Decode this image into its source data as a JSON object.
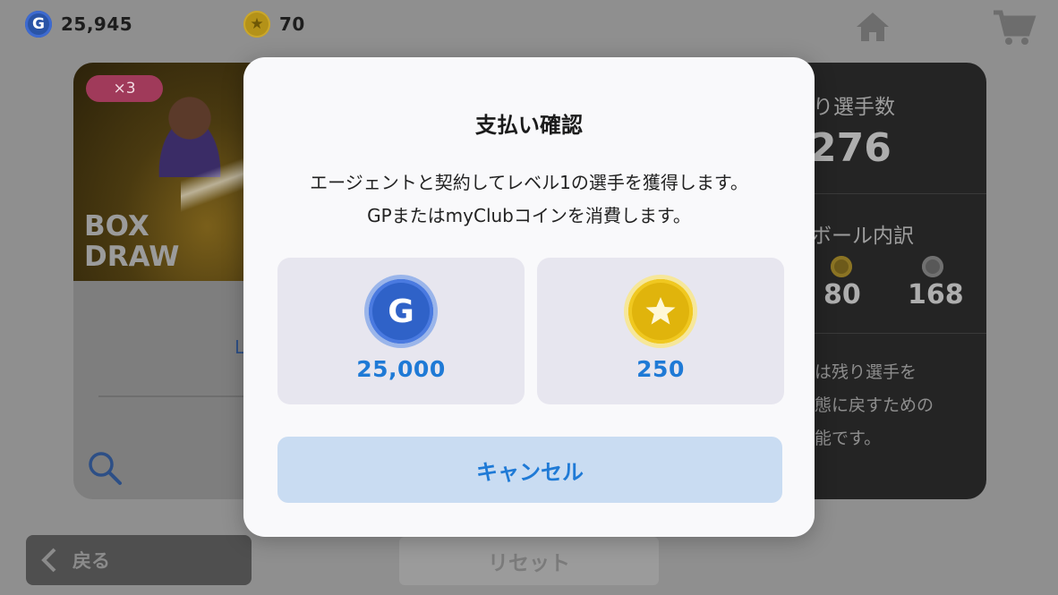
{
  "topbar": {
    "gp": {
      "icon": "gp-coin-icon",
      "letter": "G",
      "amount": "25,945"
    },
    "coins": {
      "icon": "star-coin-icon",
      "amount": "70"
    },
    "home_icon": "home-icon",
    "shop_icon": "cart-icon"
  },
  "left_card": {
    "badge": "×3",
    "title_line1": "BOX",
    "title_line2": "DRAW",
    "partial_text": "L"
  },
  "right_panel": {
    "title_partial": "り選手数",
    "total_partial": "276",
    "breakdown_partial": "ボール内訳",
    "balls": [
      {
        "icon": "gold-ball-icon",
        "value": "80"
      },
      {
        "icon": "silver-ball-icon",
        "value": "168"
      }
    ],
    "desc_lines": [
      "は残り選手を",
      "態に戻すための",
      "能です。"
    ]
  },
  "bottom": {
    "back_label": "戻る",
    "reset_label": "リセット"
  },
  "modal": {
    "title": "支払い確認",
    "message_line1": "エージェントと契約してレベル1の選手を獲得します。",
    "message_line2": "GPまたはmyClubコインを消費します。",
    "options": [
      {
        "currency": "GP",
        "icon": "gp-coin-icon",
        "letter": "G",
        "price": "25,000"
      },
      {
        "currency": "myClub coin",
        "icon": "star-coin-icon",
        "price": "250"
      }
    ],
    "cancel_label": "キャンセル"
  },
  "colors": {
    "accent": "#1f7ad6",
    "cancel_bg": "#c9dcf2",
    "option_bg": "#e7e6ef",
    "gp_blue": "#2f62c8",
    "coin_gold": "#e0b40c"
  }
}
